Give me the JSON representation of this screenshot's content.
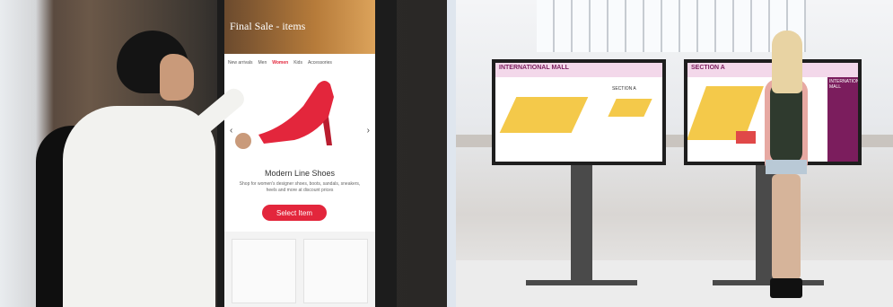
{
  "left_kiosk": {
    "hero_title": "Final Sale - items",
    "nav_items": [
      "New arrivals",
      "Men",
      "Women",
      "Kids",
      "Accessories"
    ],
    "product_title": "Modern Line Shoes",
    "product_description": "Shop for women's designer shoes, boots, sandals, sneakers, heels and more at discount prices",
    "select_button": "Select Item"
  },
  "right_kiosk": {
    "left_screen": {
      "header_title": "INTERNATIONAL MALL",
      "section_label": "SECTION A"
    },
    "right_screen": {
      "section_label": "SECTION A",
      "header_title": "INTERNATIONAL MALL"
    }
  },
  "colors": {
    "accent_red": "#e3263c",
    "mall_magenta": "#7b1d5d",
    "map_yellow": "#f4c94a"
  }
}
